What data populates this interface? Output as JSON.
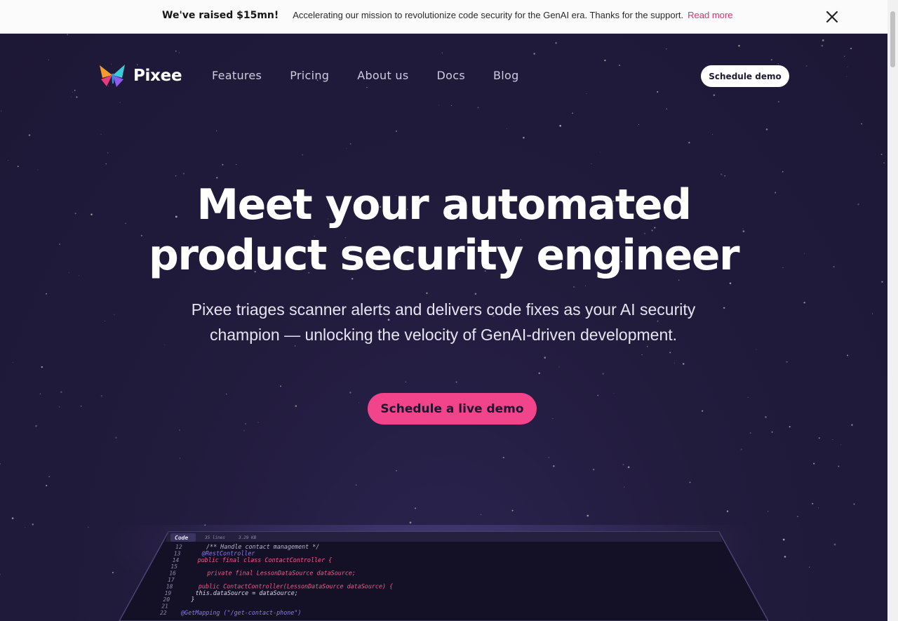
{
  "announcement": {
    "title": "We've raised $15mn!",
    "message": "Accelerating our mission to revolutionize code security for the GenAI era. Thanks for the support.",
    "link": "Read more",
    "close_icon": "close-icon"
  },
  "nav": {
    "brand": "Pixee",
    "links": [
      "Features",
      "Pricing",
      "About us",
      "Docs",
      "Blog"
    ],
    "cta": "Schedule demo"
  },
  "hero": {
    "headline_line1": "Meet your automated",
    "headline_line2": "product security engineer",
    "subtitle_line1": "Pixee triages scanner alerts and delivers code fixes as your AI security",
    "subtitle_line2": "champion — unlocking the velocity of GenAI-driven development.",
    "cta": "Schedule a live demo"
  },
  "editor": {
    "tab": "Code",
    "meta_lines": "35 lines",
    "meta_size": "3.29 KB",
    "lines": [
      {
        "num": "12",
        "code": "/** Handle contact management */"
      },
      {
        "num": "13",
        "code": "@RestController"
      },
      {
        "num": "14",
        "code": "public final class ContactController {"
      },
      {
        "num": "15",
        "code": ""
      },
      {
        "num": "16",
        "code": "private final LessonDataSource dataSource;"
      },
      {
        "num": "17",
        "code": ""
      },
      {
        "num": "18",
        "code": "public ContactController(LessonDataSource dataSource) {"
      },
      {
        "num": "19",
        "code": "this.dataSource = dataSource;"
      },
      {
        "num": "20",
        "code": "}"
      },
      {
        "num": "21",
        "code": ""
      },
      {
        "num": "22",
        "code": "@GetMapping (\"/get-contact-phone\")"
      }
    ]
  },
  "colors": {
    "background": "#1f1a3a",
    "accent": "#f2448a",
    "link": "#e0306b"
  }
}
